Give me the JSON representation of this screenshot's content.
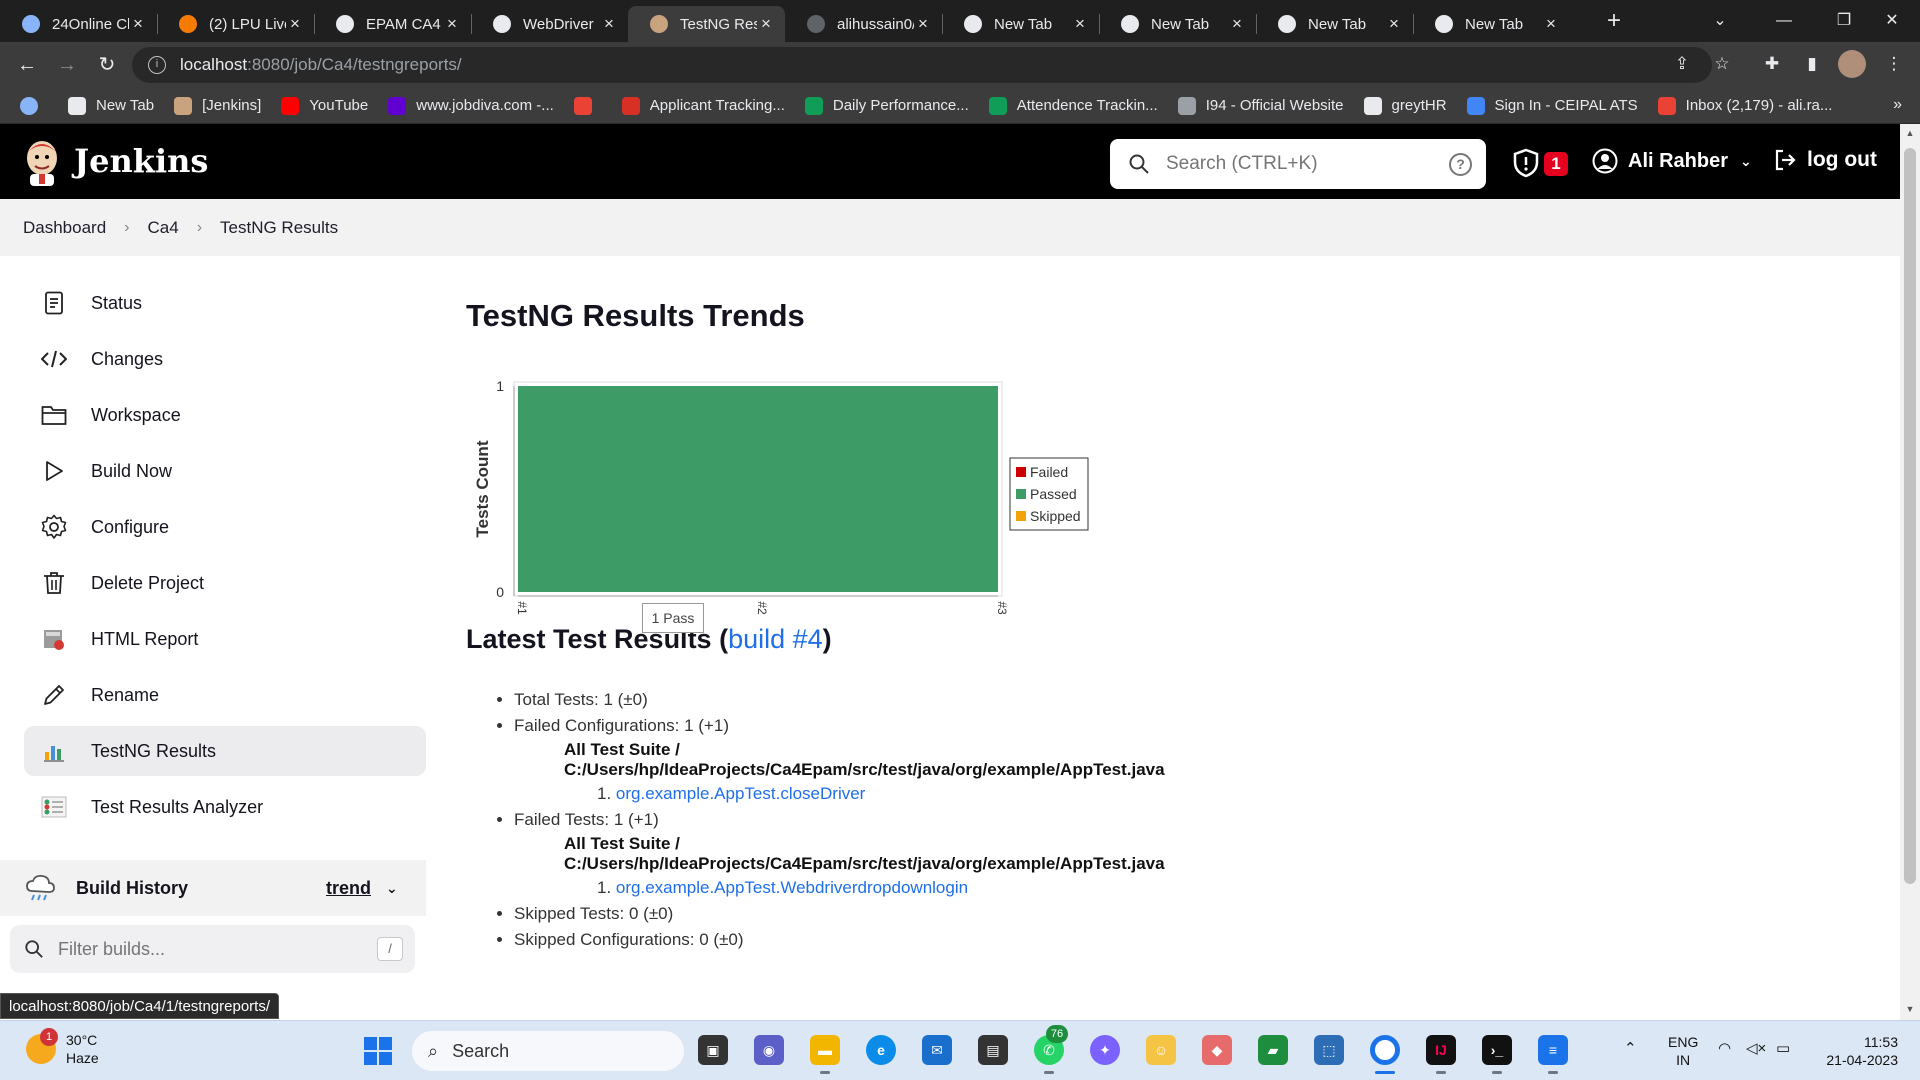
{
  "browser": {
    "tabs": [
      {
        "title": "24Online Cl",
        "color": "#8ab4f8"
      },
      {
        "title": "(2) LPU Live",
        "color": "#f57c00"
      },
      {
        "title": "EPAM CA4",
        "color": "#e8eaed"
      },
      {
        "title": "WebDriver",
        "color": "#e8eaed"
      },
      {
        "title": "TestNG Res",
        "color": "#c9a27e"
      },
      {
        "title": "alihussain0/",
        "color": "#5f6368"
      },
      {
        "title": "New Tab",
        "color": "#e8eaed"
      },
      {
        "title": "New Tab",
        "color": "#e8eaed"
      },
      {
        "title": "New Tab",
        "color": "#e8eaed"
      },
      {
        "title": "New Tab",
        "color": "#e8eaed"
      }
    ],
    "active_tab_index": 4,
    "url_host": "localhost",
    "url_path": ":8080/job/Ca4/testngreports/",
    "bookmarks": [
      {
        "label": "New Tab",
        "color": "#e8eaed"
      },
      {
        "label": "[Jenkins]",
        "color": "#c9a27e"
      },
      {
        "label": "YouTube",
        "color": "#ff0000"
      },
      {
        "label": "www.jobdiva.com -...",
        "color": "#6001d2"
      },
      {
        "label": "",
        "color": "#ea4335"
      },
      {
        "label": "Applicant Tracking...",
        "color": "#d93025"
      },
      {
        "label": "Daily Performance...",
        "color": "#0f9d58"
      },
      {
        "label": "Attendence Trackin...",
        "color": "#0f9d58"
      },
      {
        "label": "I94 - Official Website",
        "color": "#9aa0a6"
      },
      {
        "label": "greytHR",
        "color": "#e8eaed"
      },
      {
        "label": "Sign In - CEIPAL ATS",
        "color": "#4285f4"
      },
      {
        "label": "Inbox (2,179) - ali.ra...",
        "color": "#ea4335"
      }
    ],
    "status_url": "localhost:8080/job/Ca4/1/testngreports/"
  },
  "jenkins": {
    "app_title": "Jenkins",
    "search_placeholder": "Search (CTRL+K)",
    "security_count": "1",
    "user_name": "Ali Rahber",
    "logout_label": "log out"
  },
  "breadcrumb": [
    "Dashboard",
    "Ca4",
    "TestNG Results"
  ],
  "sidebar": {
    "items": [
      {
        "label": "Status",
        "icon": "status-icon"
      },
      {
        "label": "Changes",
        "icon": "code-icon"
      },
      {
        "label": "Workspace",
        "icon": "folder-icon"
      },
      {
        "label": "Build Now",
        "icon": "play-icon"
      },
      {
        "label": "Configure",
        "icon": "gear-icon"
      },
      {
        "label": "Delete Project",
        "icon": "trash-icon"
      },
      {
        "label": "HTML Report",
        "icon": "html-report-icon"
      },
      {
        "label": "Rename",
        "icon": "pencil-icon"
      },
      {
        "label": "TestNG Results",
        "icon": "testng-icon"
      },
      {
        "label": "Test Results Analyzer",
        "icon": "analyzer-icon"
      }
    ],
    "active_index": 8,
    "build_history_label": "Build History",
    "trend_label": "trend",
    "filter_placeholder": "Filter builds...",
    "filter_shortcut": "/"
  },
  "main": {
    "title": "TestNG Results Trends",
    "latest_prefix": "Latest Test Results (",
    "latest_link": "build #4",
    "latest_suffix": ")",
    "tooltip": "1 Pass",
    "results": {
      "total_tests": "Total Tests: 1 (±0)",
      "failed_configurations": "Failed Configurations: 1 (+1)",
      "suite_1": "All Test Suite / C:/Users/hp/IdeaProjects/Ca4Epam/src/test/java/org/example/AppTest.java",
      "config_1": "org.example.AppTest.closeDriver",
      "failed_tests": "Failed Tests: 1 (+1)",
      "suite_2": "All Test Suite / C:/Users/hp/IdeaProjects/Ca4Epam/src/test/java/org/example/AppTest.java",
      "test_1": "org.example.AppTest.Webdriverdropdownlogin",
      "skipped_tests": "Skipped Tests: 0 (±0)",
      "skipped_configurations": "Skipped Configurations: 0 (±0)"
    }
  },
  "chart_data": {
    "type": "area",
    "categories": [
      "#1",
      "#2",
      "#3"
    ],
    "series": [
      {
        "name": "Failed",
        "values": [
          0,
          0,
          0
        ],
        "color": "#cc0000"
      },
      {
        "name": "Passed",
        "values": [
          1,
          1,
          1
        ],
        "color": "#3d9b65"
      },
      {
        "name": "Skipped",
        "values": [
          0,
          0,
          0
        ],
        "color": "#f0a30a"
      }
    ],
    "ylabel": "Tests Count",
    "ylim": [
      0,
      1
    ],
    "yticks": [
      "0",
      "1"
    ],
    "legend": "right"
  },
  "taskbar": {
    "temperature": "30°C",
    "condition": "Haze",
    "weather_badge": "1",
    "search_label": "Search",
    "whatsapp_badge": "76",
    "lang_1": "ENG",
    "lang_2": "IN",
    "time": "11:53",
    "date": "21-04-2023"
  }
}
